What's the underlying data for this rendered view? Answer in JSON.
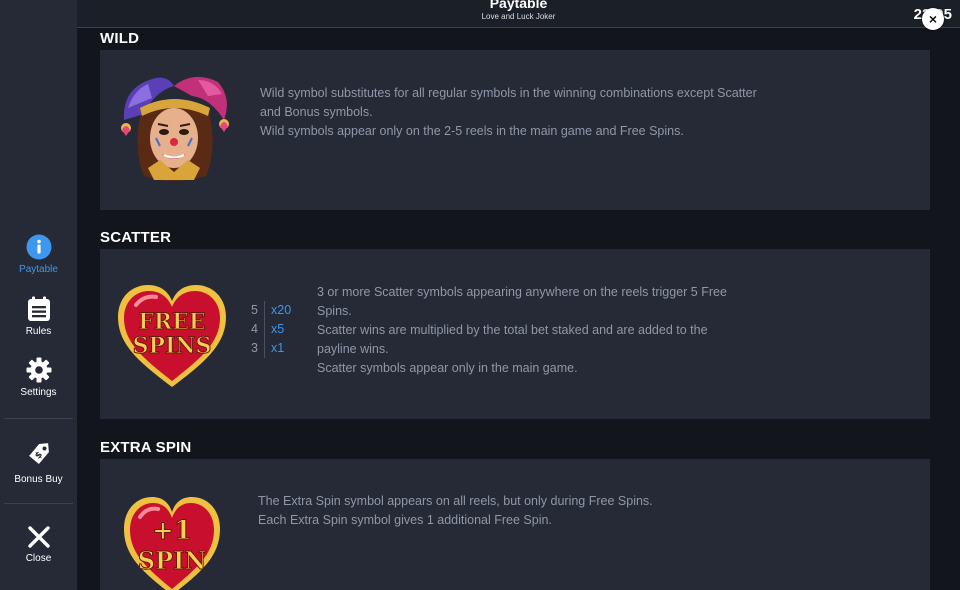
{
  "header": {
    "title": "Paytable",
    "subtitle": "Love and Luck Joker",
    "clock": "22:05"
  },
  "sidebar": {
    "items": [
      {
        "label": "Paytable",
        "icon": "info-icon",
        "active": true
      },
      {
        "label": "Rules",
        "icon": "rules-icon"
      },
      {
        "label": "Settings",
        "icon": "gear-icon"
      },
      {
        "label": "Bonus Buy",
        "icon": "tag-icon"
      },
      {
        "label": "Close",
        "icon": "close-icon"
      }
    ]
  },
  "sections": {
    "wild": {
      "title": "WILD",
      "lines": [
        "Wild symbol substitutes for all regular symbols in the winning combinations except Scatter",
        "and Bonus symbols.",
        "Wild symbols appear only on the 2-5 reels in the main game and Free Spins."
      ]
    },
    "scatter": {
      "title": "SCATTER",
      "symbol_text": [
        "FREE",
        "SPINS"
      ],
      "pays": [
        {
          "count": "5",
          "mult": "x20"
        },
        {
          "count": "4",
          "mult": "x5"
        },
        {
          "count": "3",
          "mult": "x1"
        }
      ],
      "lines": [
        "3 or more Scatter symbols appearing anywhere on the reels trigger 5 Free",
        "Spins.",
        "Scatter wins are multiplied by the total bet staked and are added to the",
        "payline wins.",
        "Scatter symbols appear only in the main game."
      ]
    },
    "extra_spin": {
      "title": "EXTRA SPIN",
      "symbol_text": [
        "+1",
        "SPIN"
      ],
      "lines": [
        "The Extra Spin symbol appears on all reels, but only during Free Spins.",
        "Each Extra Spin symbol gives 1 additional Free Spin."
      ]
    }
  },
  "colors": {
    "accent": "#3d97ee",
    "panel": "#252a36",
    "background": "#12151c",
    "text_muted": "#8f97a8"
  }
}
